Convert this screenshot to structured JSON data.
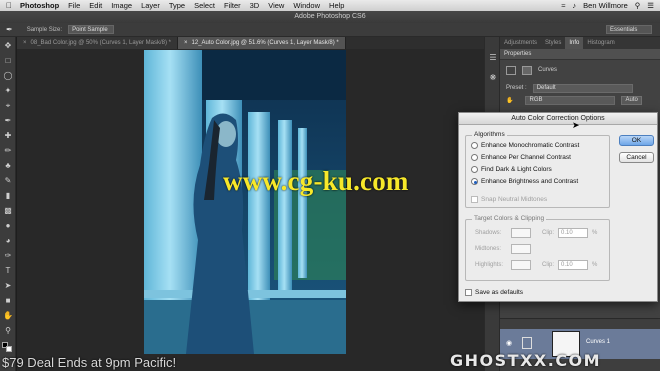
{
  "menubar": {
    "app": "Photoshop",
    "items": [
      "File",
      "Edit",
      "Image",
      "Layer",
      "Type",
      "Select",
      "Filter",
      "3D",
      "View",
      "Window",
      "Help"
    ],
    "user": "Ben Willmore"
  },
  "window_title": "Adobe Photoshop CS6",
  "options_bar": {
    "sample_size_label": "Sample Size:",
    "sample_size_value": "Point Sample",
    "workspace": "Essentials"
  },
  "doc_tabs": [
    {
      "label": "08_Bad Color.jpg @ 50% (Curves 1, Layer Mask/8) *"
    },
    {
      "label": "12_Auto Color.jpg @ 51.6% (Curves 1, Layer Mask/8) *"
    }
  ],
  "panel": {
    "tabs": [
      "Adjustments",
      "Styles",
      "Info",
      "Histogram"
    ],
    "properties_title": "Properties",
    "curves_label": "Curves",
    "preset_label": "Preset :",
    "preset_value": "Default",
    "channel_value": "RGB",
    "auto_label": "Auto",
    "layer_name": "Curves 1"
  },
  "dialog": {
    "title": "Auto Color Correction Options",
    "algorithms_title": "Algorithms",
    "algorithms": [
      {
        "label": "Enhance Monochromatic Contrast",
        "selected": false
      },
      {
        "label": "Enhance Per Channel Contrast",
        "selected": false
      },
      {
        "label": "Find Dark & Light Colors",
        "selected": false
      },
      {
        "label": "Enhance Brightness and Contrast",
        "selected": true
      }
    ],
    "snap_label": "Snap Neutral Midtones",
    "targets_title": "Target Colors & Clipping",
    "shadows_label": "Shadows:",
    "midtones_label": "Midtones:",
    "highlights_label": "Highlights:",
    "clip_label": "Clip:",
    "shadows_clip": "0.10",
    "highlights_clip": "0.10",
    "percent": "%",
    "save_defaults_label": "Save as defaults",
    "ok_label": "OK",
    "cancel_label": "Cancel"
  },
  "overlays": {
    "center_watermark": "www.cg-ku.com",
    "corner_watermark": "GHOSTXX.COM",
    "promo": "$79 Deal Ends at 9pm Pacific!"
  }
}
